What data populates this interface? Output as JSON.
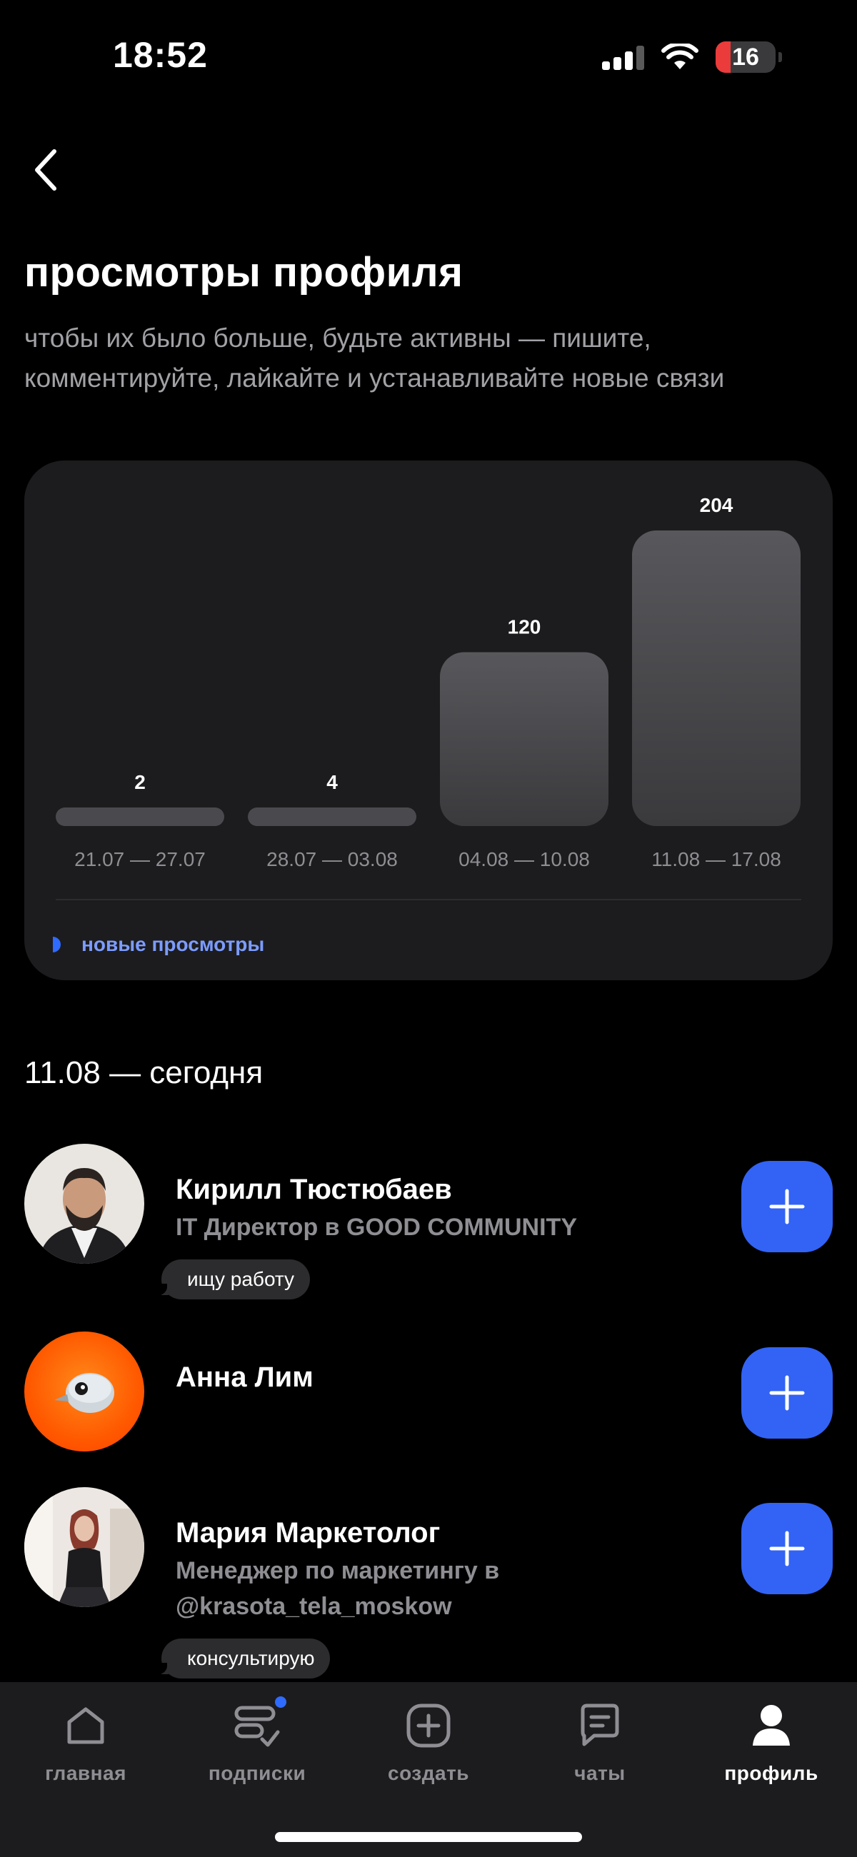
{
  "status_bar": {
    "time": "18:52",
    "battery": "16",
    "battery_level": 0.16,
    "battery_color": "#eb3b3b"
  },
  "header": {
    "title": "просмотры профиля",
    "subtitle": "чтобы их было больше, будьте активны — пишите, комментируйте, лайкайте и устанавливайте новые связи"
  },
  "chart_data": {
    "type": "bar",
    "categories": [
      "21.07 — 27.07",
      "28.07 — 03.08",
      "04.08 — 10.08",
      "11.08 — 17.08"
    ],
    "values": [
      2,
      4,
      120,
      204
    ],
    "series": [
      {
        "name": "новые просмотры",
        "values": [
          2,
          4,
          120,
          204
        ]
      }
    ],
    "bar_color": "#4a4a4e",
    "legend_color": "#2f6bff"
  },
  "legend": {
    "label": "новые просмотры"
  },
  "section": {
    "date_label": "11.08 — сегодня"
  },
  "people": [
    {
      "name": "Кирилл Тюстюбаев",
      "role": "IT Директор в GOOD COMMUNITY",
      "tag": "ищу работу"
    },
    {
      "name": "Анна Лим",
      "role": "",
      "tag": ""
    },
    {
      "name": "Мария Маркетолог",
      "role": "Менеджер по маркетингу в @krasota_tela_moskow",
      "tag": "консультирую"
    }
  ],
  "tabs": [
    {
      "label": "главная",
      "icon": "home-icon"
    },
    {
      "label": "подписки",
      "icon": "subscriptions-icon"
    },
    {
      "label": "создать",
      "icon": "create-icon"
    },
    {
      "label": "чаты",
      "icon": "chat-icon"
    },
    {
      "label": "профиль",
      "icon": "profile-icon"
    }
  ],
  "active_tab": "профиль",
  "accent_color": "#3263f5"
}
